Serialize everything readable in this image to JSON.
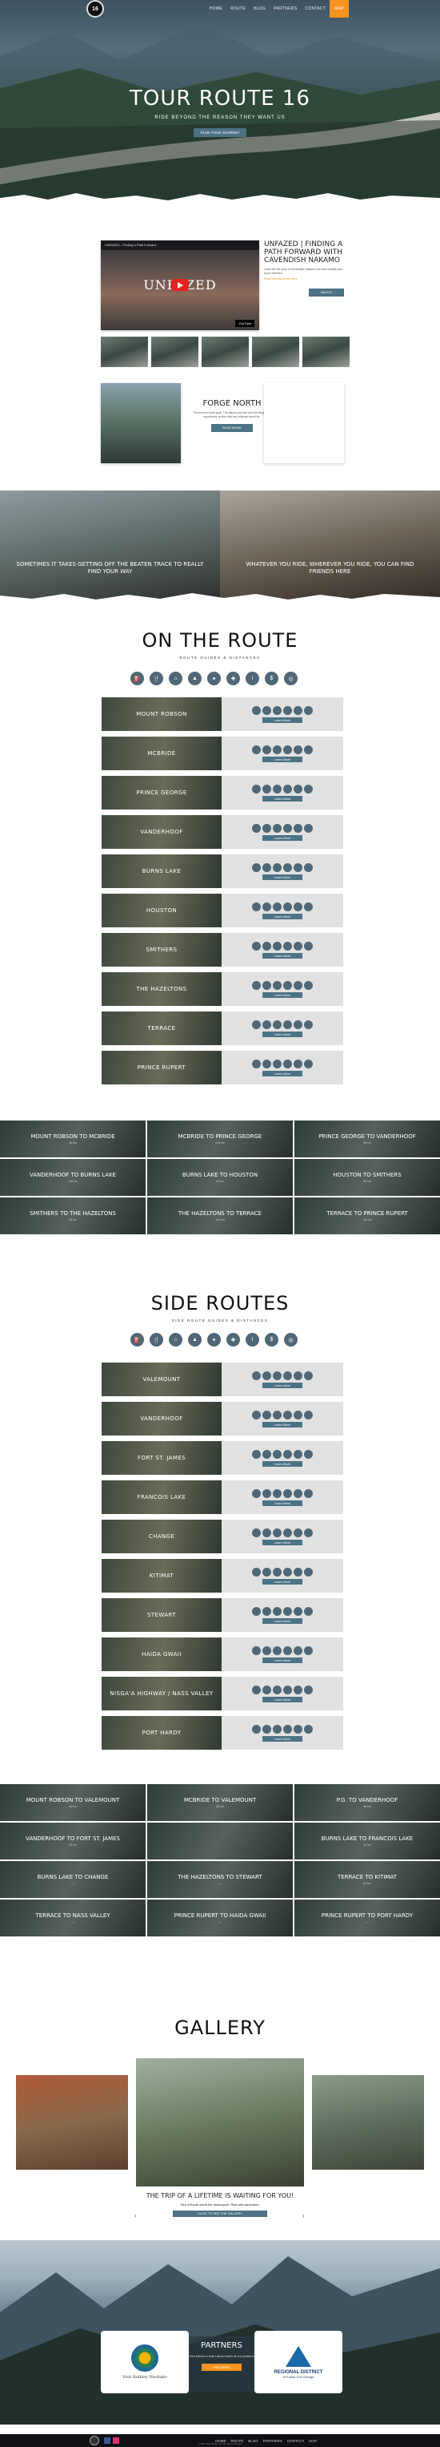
{
  "nav": {
    "items": [
      "HOME",
      "ROUTE",
      "BLOG",
      "PARTNERS",
      "CONTACT"
    ],
    "cta": "MAP"
  },
  "hero": {
    "title": "TOUR ROUTE 16",
    "subtitle": "RIDE BEYOND THE REASON THEY WANT US",
    "button": "PLAN YOUR JOURNEY"
  },
  "video": {
    "bar_title": "UNFAZED - Finding a Path Forward",
    "brand": "UNFAZED",
    "yt": "YouTube",
    "heading": "UNFAZED | FINDING A PATH FORWARD WITH CAVENDISH NAKAMO",
    "body": "Learn the life story of Cavendish Nakamo who lost mobility and found freedom.",
    "link": "Read more about the story",
    "more": "WATCH"
  },
  "forge": {
    "title": "FORGE NORTH",
    "body": "The journey is the goal. The places you see and the things you experience on the road are what we travel for.",
    "button": "READ MORE"
  },
  "band1": {
    "left": "SOMETIMES IT TAKES GETTING OFF THE BEATEN TRACK TO REALLY FIND YOUR WAY",
    "right": "WHATEVER YOU RIDE, WHEREVER YOU RIDE, YOU CAN FIND FRIENDS HERE"
  },
  "on_route": {
    "title": "ON THE ROUTE",
    "subtitle": "ROUTE GUIDES & DISTANCES",
    "learn": "Learn More",
    "routes": [
      "MOUNT ROBSON",
      "MCBRIDE",
      "PRINCE GEORGE",
      "VANDERHOOF",
      "BURNS LAKE",
      "HOUSTON",
      "SMITHERS",
      "THE HAZELTONS",
      "TERRACE",
      "PRINCE RUPERT"
    ]
  },
  "legs1": {
    "tiles": [
      {
        "t": "MOUNT ROBSON TO MCBRIDE",
        "s": "95 km"
      },
      {
        "t": "MCBRIDE TO PRINCE GEORGE",
        "s": "210 km"
      },
      {
        "t": "PRINCE GEORGE TO VANDERHOOF",
        "s": "98 km"
      },
      {
        "t": "VANDERHOOF TO BURNS LAKE",
        "s": "130 km"
      },
      {
        "t": "BURNS LAKE TO HOUSTON",
        "s": "83 km"
      },
      {
        "t": "HOUSTON TO SMITHERS",
        "s": "65 km"
      },
      {
        "t": "SMITHERS TO THE HAZELTONS",
        "s": "68 km"
      },
      {
        "t": "THE HAZELTONS TO TERRACE",
        "s": "140 km"
      },
      {
        "t": "TERRACE TO PRINCE RUPERT",
        "s": "144 km"
      }
    ]
  },
  "side_routes": {
    "title": "SIDE ROUTES",
    "subtitle": "SIDE ROUTE GUIDES & DISTANCES",
    "routes": [
      "VALEMOUNT",
      "VANDERHOOF",
      "FORT ST. JAMES",
      "FRANCOIS LAKE",
      "CHANGE",
      "KITIMAT",
      "STEWART",
      "HAIDA GWAII",
      "NISGA'A HIGHWAY / NASS VALLEY",
      "PORT HARDY"
    ]
  },
  "legs2": {
    "tiles": [
      {
        "t": "MOUNT ROBSON TO VALEMOUNT",
        "s": "34 km"
      },
      {
        "t": "MCBRIDE TO VALEMOUNT",
        "s": "85 km"
      },
      {
        "t": "P.G. TO VANDERHOOF",
        "s": "98 km"
      },
      {
        "t": "VANDERHOOF TO FORT ST. JAMES",
        "s": "62 km"
      },
      {
        "t": "",
        "s": ""
      },
      {
        "t": "BURNS LAKE TO FRANCOIS LAKE",
        "s": "24 km"
      },
      {
        "t": "BURNS LAKE TO CHANGE",
        "s": "—"
      },
      {
        "t": "THE HAZELTONS TO STEWART",
        "s": "—"
      },
      {
        "t": "TERRACE TO KITIMAT",
        "s": "62 km"
      },
      {
        "t": "TERRACE TO NASS VALLEY",
        "s": "—"
      },
      {
        "t": "PRINCE RUPERT TO HAIDA GWAII",
        "s": "—"
      },
      {
        "t": "PRINCE RUPERT TO PORT HARDY",
        "s": "—"
      }
    ]
  },
  "gallery": {
    "title": "GALLERY",
    "caption": "THE TRIP OF A LIFETIME IS WAITING FOR YOU!",
    "sub": "Tour a Route worth the motorcycle. Ride with adventure.",
    "button": "CLICK TO SEE THE GALLERY"
  },
  "partners": {
    "title": "PARTNERS",
    "body": "Click below to learn about each of our partners.",
    "button": "PARTNERS",
    "left": "Visit Bulkley Nechako",
    "right_a": "REGIONAL DISTRICT",
    "right_b": "of Fraser-Fort George"
  },
  "footer": {
    "nav": [
      "HOME",
      "ROUTE",
      "BLOG",
      "PARTNERS",
      "CONTACT",
      "MAP"
    ],
    "copy": "© 2023 Tour Route 16. All rights reserved."
  }
}
